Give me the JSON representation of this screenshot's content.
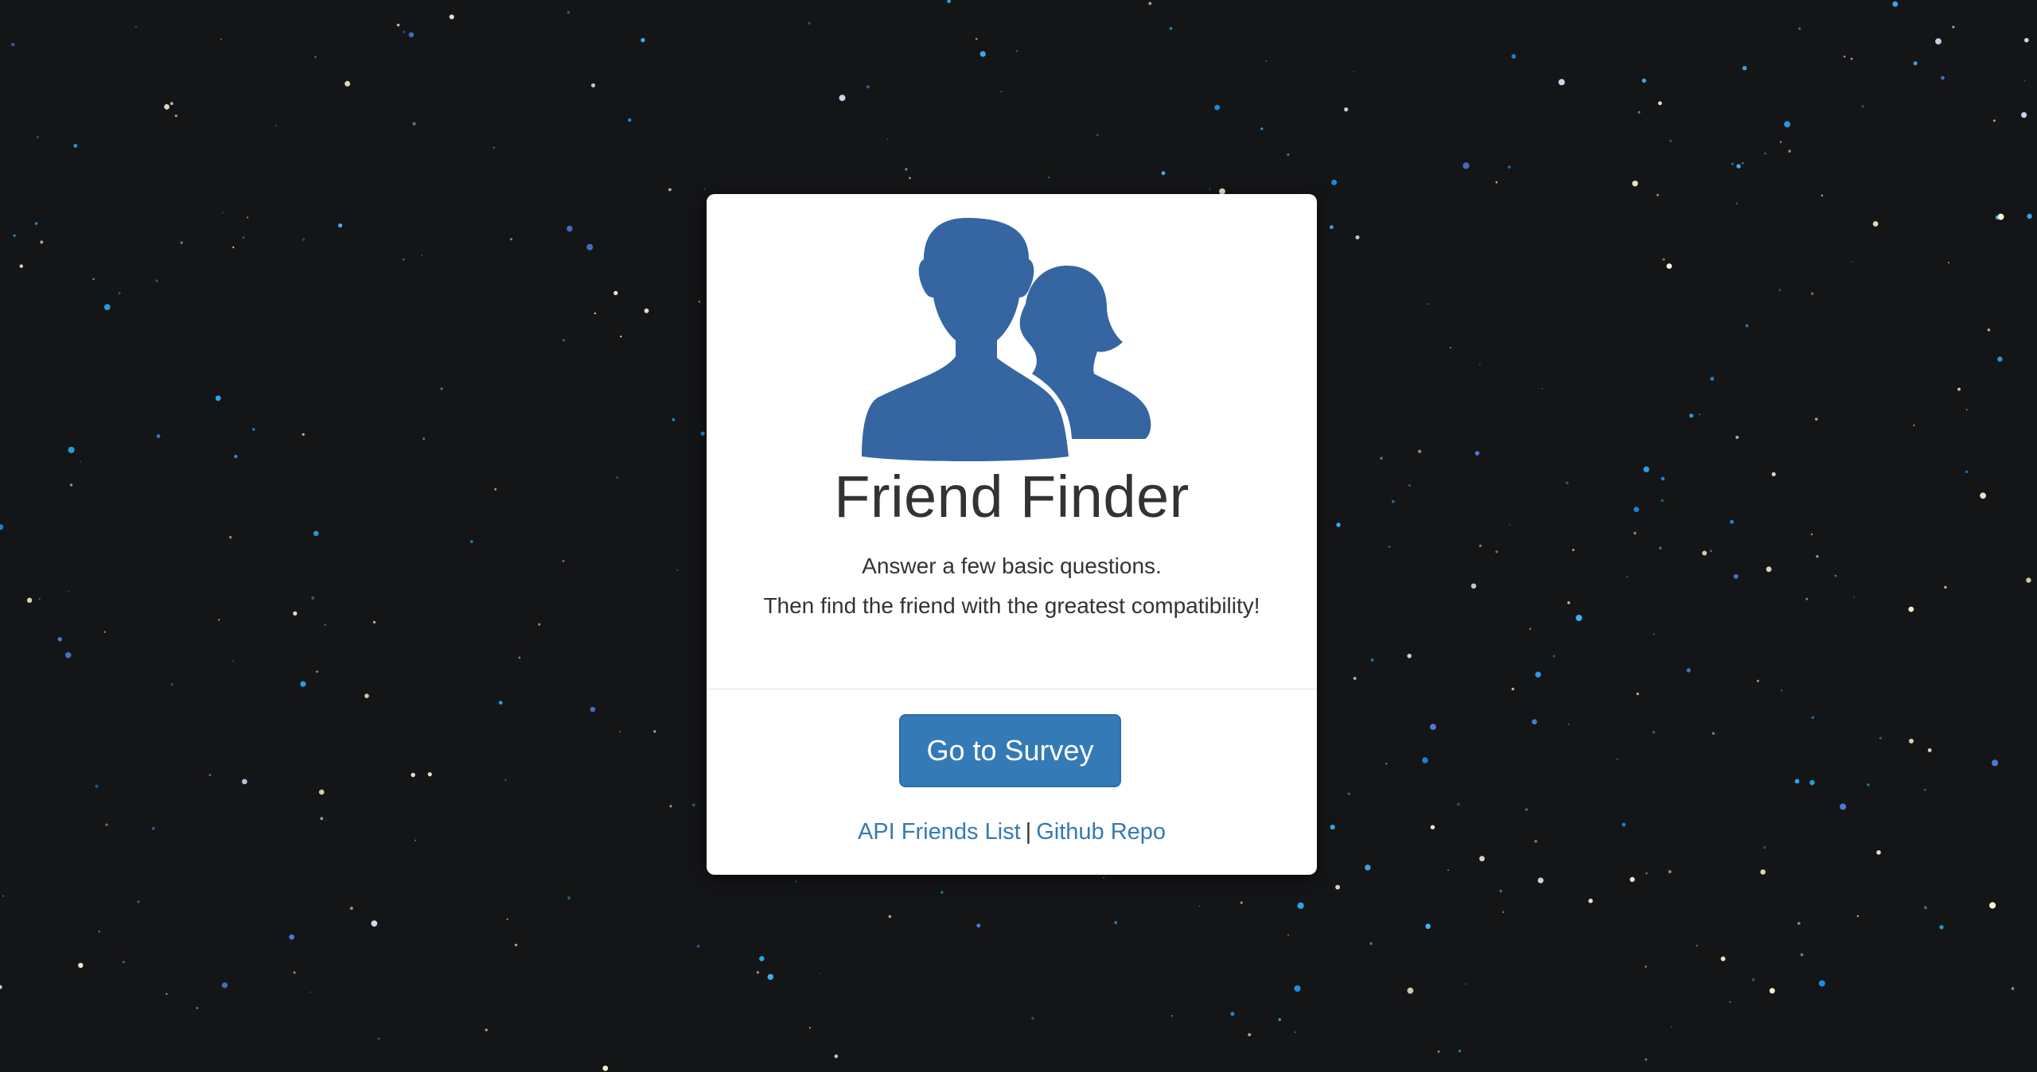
{
  "page": {
    "background_color": "#141517"
  },
  "card": {
    "logo_icon": "users-icon",
    "logo_color": "#3566a2",
    "title": "Friend Finder",
    "subtitle_line1": "Answer a few basic questions.",
    "subtitle_line2": "Then find the friend with the greatest compatibility!",
    "survey_button_label": "Go to Survey",
    "button_color": "#337ab7",
    "links": {
      "api_label": "API Friends List",
      "separator": "|",
      "github_label": "Github Repo"
    }
  }
}
